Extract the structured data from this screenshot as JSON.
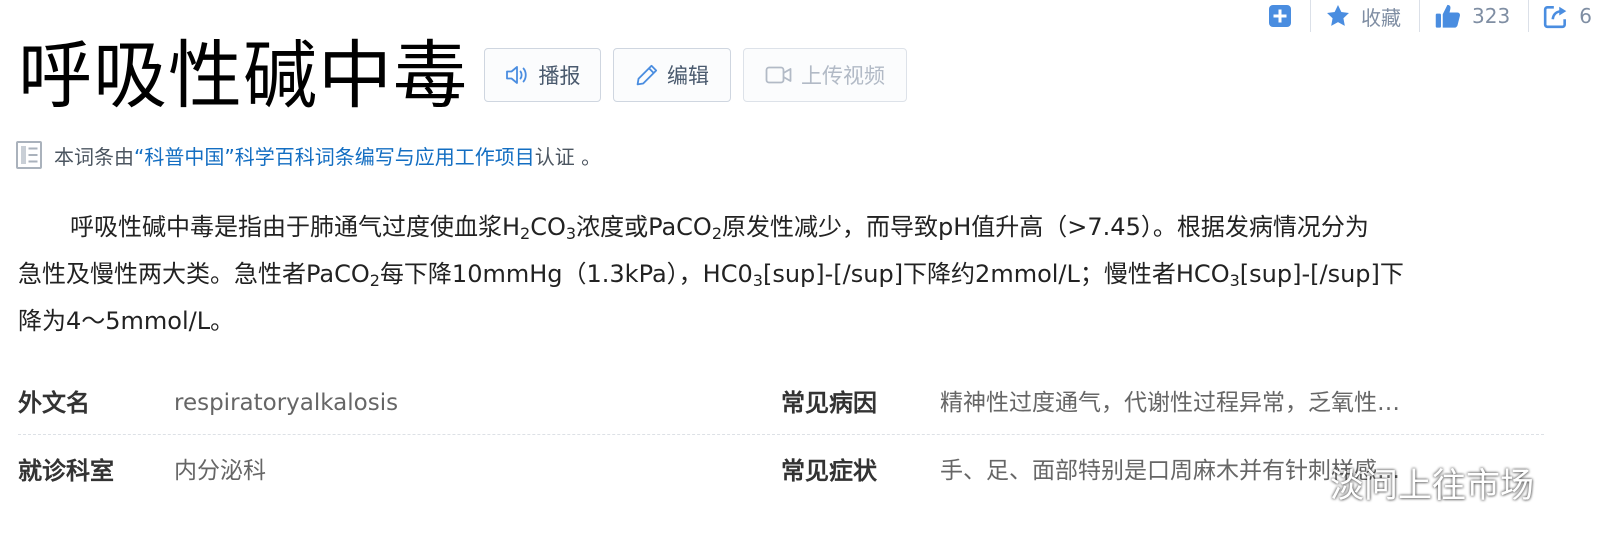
{
  "actions": {
    "favorite_label": "收藏",
    "like_count": "323",
    "share_count": "6"
  },
  "title": "呼吸性碱中毒",
  "title_buttons": {
    "broadcast": "播报",
    "edit": "编辑",
    "upload_video": "上传视频"
  },
  "certification": {
    "prefix": "本词条由",
    "link": "“科普中国”科学百科词条编写与应用工作项目",
    "suffix": " 认证 。"
  },
  "summary": {
    "l1a": "呼吸性碱中毒是指由于肺通气过度使血浆H",
    "l1s1": "2",
    "l1b": "CO",
    "l1s2": "3",
    "l1c": "浓度或PaCO",
    "l1s3": "2",
    "l1d": "原发性减少，而导致pH值升高（>7.45）。根据发病情况分为",
    "l2a": "急性及慢性两大类。急性者PaCO",
    "l2s1": "2",
    "l2b": "每下降10mmHg（1.3kPa），HC0",
    "l2s2": "3",
    "l2c": "[sup]-[/sup]下降约2mmol/L；慢性者HCO",
    "l2s3": "3",
    "l2d": "[sup]-[/sup]下",
    "l3": "降为4～5mmol/L。"
  },
  "basic_info": [
    {
      "left_label": "外文名",
      "left_value": "respiratoryalkalosis",
      "right_label": "常见病因",
      "right_value": "精神性过度通气，代谢性过程异常，乏氧性…"
    },
    {
      "left_label": "就诊科室",
      "left_value": "内分泌科",
      "right_label": "常见症状",
      "right_value": "手、足、面部特别是口周麻木并有针刺样感…"
    }
  ],
  "watermark": "淡问上往市场",
  "colors": {
    "link": "#136ec2",
    "action_icon": "#4a8de0",
    "title": "#000000"
  }
}
